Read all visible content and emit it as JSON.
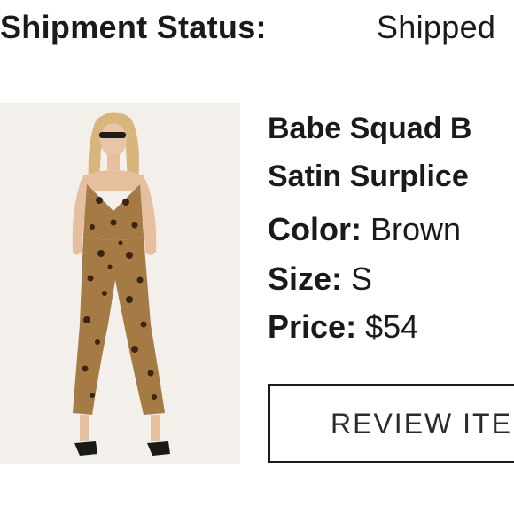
{
  "shipment": {
    "label": "Shipment Status:",
    "value": "Shipped"
  },
  "product": {
    "title_line1": "Babe Squad B",
    "title_line2": "Satin Surplice",
    "color_label": "Color:",
    "color_value": "Brown",
    "size_label": "Size:",
    "size_value": "S",
    "price_label": "Price:",
    "price_value": "$54"
  },
  "actions": {
    "review_label": "REVIEW ITE"
  }
}
